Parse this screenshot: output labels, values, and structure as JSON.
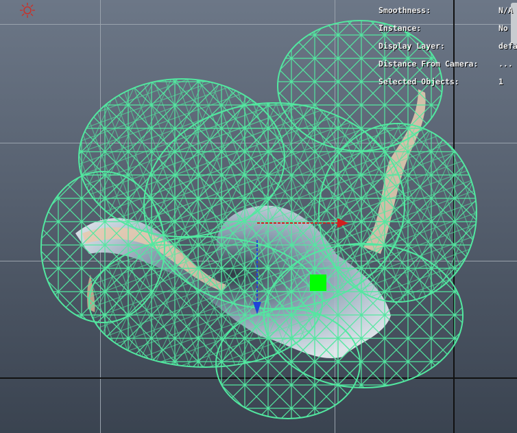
{
  "hud": {
    "rows": [
      {
        "label": "Smoothness:",
        "value": "N/A"
      },
      {
        "label": "Instance:",
        "value": "No"
      },
      {
        "label": "Display Layer:",
        "value": "default"
      },
      {
        "label": "Distance From Camera:",
        "value": "..."
      },
      {
        "label": "Selected Objects:",
        "value": "1"
      }
    ]
  },
  "icons": {
    "light": "sun-icon"
  },
  "colors": {
    "wireframe": "#52e8a0",
    "x_axis": "#d21f1f",
    "y_axis": "#1f44d8",
    "pivot": "#00ff00"
  }
}
